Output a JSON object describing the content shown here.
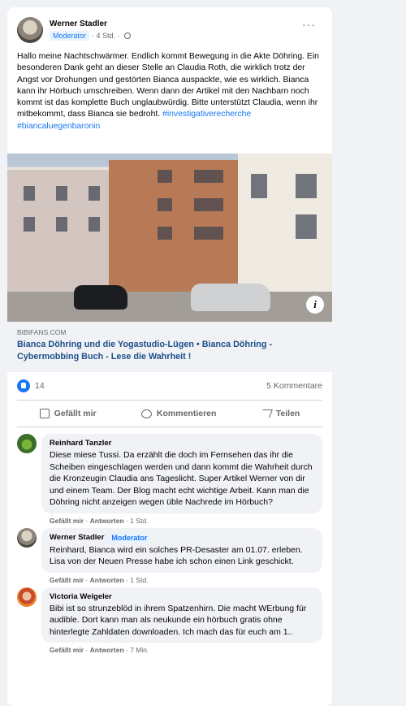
{
  "post": {
    "author": "Werner Stadler",
    "role_badge": "Moderator",
    "time": "· 4 Std. ·",
    "more": "···",
    "text": "Hallo meine Nachtschwärmer. Endlich kommt Bewegung in die Akte Döhring. Ein besonderen Dank geht an dieser Stelle an Claudia Roth, die wirklich trotz der Angst vor Drohungen und gestörten Bianca auspackte, wie es wirklich. Bianca kann ihr Hörbuch umschreiben. Wenn dann der Artikel mit den Nachbarn noch kommt ist das komplette Buch unglaubwürdig. Bitte unterstützt Claudia, wenn ihr mitbekommt, dass Bianca sie bedroht.",
    "hashtags": "#investigativerecherche #biancaluegenbaronin"
  },
  "link": {
    "info_icon": "i",
    "domain": "BIBIFANS.COM",
    "title": "Bianca Döhring und die Yogastudio-Lügen • Bianca Döhring - Cybermobbing Buch - Lese die Wahrheit !"
  },
  "stats": {
    "likes": "14",
    "comments": "5 Kommentare"
  },
  "actions": {
    "like": "Gefällt mir",
    "comment": "Kommentieren",
    "share": "Teilen"
  },
  "comments": [
    {
      "author": "Reinhard Tanzler",
      "badge": "",
      "text": "Diese miese Tussi. Da erzählt die doch im Fernsehen das ihr die Scheiben eingeschlagen werden und dann kommt die Wahrheit durch die Kronzeugin Claudia ans Tageslicht. Super Artikel Werner von dir und einem Team. Der Blog macht echt wichtige Arbeit. Kann man die Döhring nicht anzeigen wegen üble Nachrede im Hörbuch?",
      "like": "Gefällt mir",
      "reply": "Antworten",
      "time": "1 Std."
    },
    {
      "author": "Werner Stadler",
      "badge": "Moderator",
      "text": "Reinhard, Bianca wird ein solches PR-Desaster am 01.07. erleben. Lisa von der Neuen Presse habe ich schon einen Link geschickt.",
      "like": "Gefällt mir",
      "reply": "Antworten",
      "time": "1 Std."
    },
    {
      "author": "Victoria Weigeler",
      "badge": "",
      "text": "Bibi ist so strunzeblöd in ihrem Spatzenhirn. Die macht WErbung für audible. Dort kann man als neukunde ein hörbuch gratis ohne hinterlegte Zahldaten downloaden. Ich mach das für euch am 1..",
      "like": "Gefällt mir",
      "reply": "Antworten",
      "time": "7 Min."
    }
  ]
}
